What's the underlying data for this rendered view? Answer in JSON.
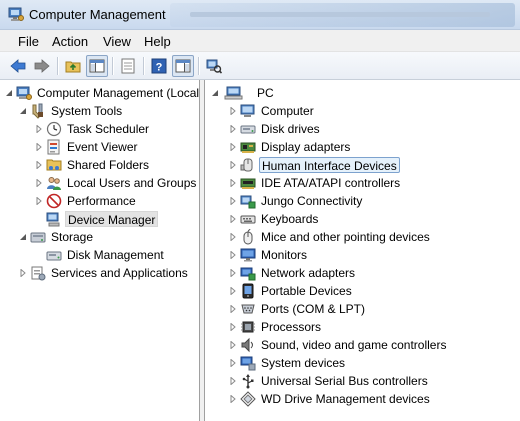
{
  "window": {
    "title": "Computer Management"
  },
  "menu": {
    "file": "File",
    "action": "Action",
    "view": "View",
    "help": "Help"
  },
  "left_tree": {
    "root": "Computer Management (Local",
    "system_tools": "System Tools",
    "task_scheduler": "Task Scheduler",
    "event_viewer": "Event Viewer",
    "shared_folders": "Shared Folders",
    "local_users": "Local Users and Groups",
    "performance": "Performance",
    "device_manager": "Device Manager",
    "storage": "Storage",
    "disk_management": "Disk Management",
    "services": "Services and Applications"
  },
  "device_tree": {
    "root": "PC",
    "items": [
      {
        "label": "Computer",
        "icon": "computer-icon"
      },
      {
        "label": "Disk drives",
        "icon": "disk-drive-icon"
      },
      {
        "label": "Display adapters",
        "icon": "display-adapter-icon"
      },
      {
        "label": "Human Interface Devices",
        "icon": "hid-icon"
      },
      {
        "label": "IDE ATA/ATAPI controllers",
        "icon": "ide-controller-icon"
      },
      {
        "label": "Jungo Connectivity",
        "icon": "jungo-icon"
      },
      {
        "label": "Keyboards",
        "icon": "keyboard-icon"
      },
      {
        "label": "Mice and other pointing devices",
        "icon": "mouse-icon"
      },
      {
        "label": "Monitors",
        "icon": "monitor-icon"
      },
      {
        "label": "Network adapters",
        "icon": "network-adapter-icon"
      },
      {
        "label": "Portable Devices",
        "icon": "portable-device-icon"
      },
      {
        "label": "Ports (COM & LPT)",
        "icon": "port-icon"
      },
      {
        "label": "Processors",
        "icon": "processor-icon"
      },
      {
        "label": "Sound, video and game controllers",
        "icon": "sound-icon"
      },
      {
        "label": "System devices",
        "icon": "system-device-icon"
      },
      {
        "label": "Universal Serial Bus controllers",
        "icon": "usb-icon"
      },
      {
        "label": "WD Drive Management devices",
        "icon": "wd-drive-icon"
      }
    ]
  },
  "colors": {
    "selection_blue": "#e5f1fb",
    "selection_border": "#7da2ce",
    "selection_gray": "#e3e3e3"
  }
}
